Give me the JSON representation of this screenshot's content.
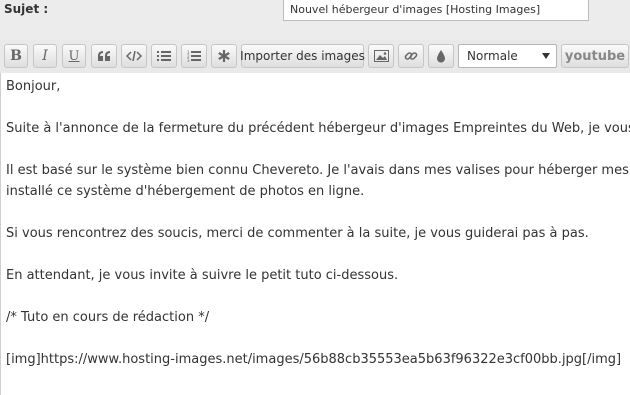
{
  "subject": {
    "label": "Sujet :",
    "value": "Nouvel hébergeur d'images [Hosting Images]"
  },
  "toolbar": {
    "bold_label": "B",
    "italic_label": "I",
    "underline_label": "U",
    "import_label": "Importer des images",
    "size_select_value": "Normale",
    "youtube_label": "youtube",
    "icons": [
      "quote-icon",
      "code-icon",
      "bullet-list-icon",
      "numbered-list-icon",
      "asterisk-icon",
      "image-icon",
      "link-icon",
      "color-drop-icon"
    ]
  },
  "editor": {
    "lines": [
      "Bonjour,",
      "Suite à l'annonce de la fermeture du précédent hébergeur d'images Empreintes du Web, je vous propose",
      "Il est basé sur le système bien connu Chevereto. Je l'avais dans mes valises pour héberger mes futurs",
      "installé ce système d'hébergement de photos en ligne.",
      "Si vous rencontrez des soucis, merci de commenter à la suite, je vous guiderai pas à pas.",
      "En attendant, je vous invite à suivre le petit tuto ci-dessous.",
      "/* Tuto en cours de rédaction */",
      "[img]https://www.hosting-images.net/images/56b88cb35553ea5b63f96322e3cf00bb.jpg[/img]"
    ]
  }
}
